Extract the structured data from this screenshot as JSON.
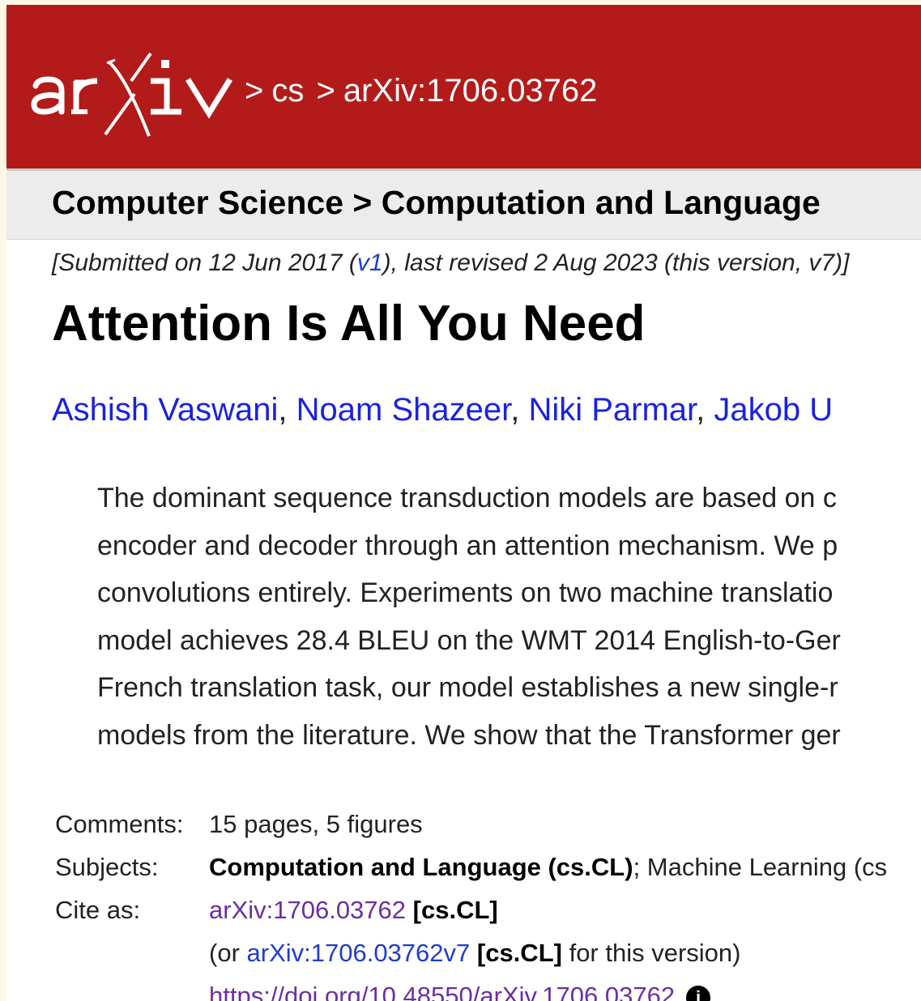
{
  "header": {
    "logo_text": "arXiv",
    "breadcrumb": [
      ">",
      "cs",
      ">",
      "arXiv:1706.03762"
    ]
  },
  "subject_bar": "Computer Science > Computation and Language",
  "dateline": {
    "prefix": "[Submitted on 12 Jun 2017 (",
    "v1_link": "v1",
    "suffix": "), last revised 2 Aug 2023 (this version, v7)]"
  },
  "title": "Attention Is All You Need",
  "authors": {
    "names": [
      "Ashish Vaswani",
      "Noam Shazeer",
      "Niki Parmar",
      "Jakob U"
    ],
    "separator": ", "
  },
  "abstract_lines": [
    "The dominant sequence transduction models are based on c",
    "encoder and decoder through an attention mechanism. We p",
    "convolutions entirely. Experiments on two machine translatio",
    "model achieves 28.4 BLEU on the WMT 2014 English-to-Ger",
    "French translation task, our model establishes a new single-r",
    "models from the literature. We show that the Transformer ger"
  ],
  "meta": {
    "comments_label": "Comments:",
    "comments_value": "15 pages, 5 figures",
    "subjects_label": "Subjects:",
    "subjects_primary": "Computation and Language (cs.CL)",
    "subjects_rest": "; Machine Learning (cs",
    "cite_label": "Cite as:",
    "cite_link": "arXiv:1706.03762",
    "cite_tag": "[cs.CL]",
    "version_prefix": "(or ",
    "version_link": "arXiv:1706.03762v7",
    "version_tag": "[cs.CL]",
    "version_suffix": " for this version)",
    "doi_link": "https://doi.org/10.48550/arXiv.1706.03762"
  },
  "colors": {
    "header_red": "#b31b1b",
    "link_blue": "#1f3dcc",
    "visited_purple": "#6b2fa1"
  },
  "icons": [
    "arxiv-logo",
    "info-icon"
  ]
}
